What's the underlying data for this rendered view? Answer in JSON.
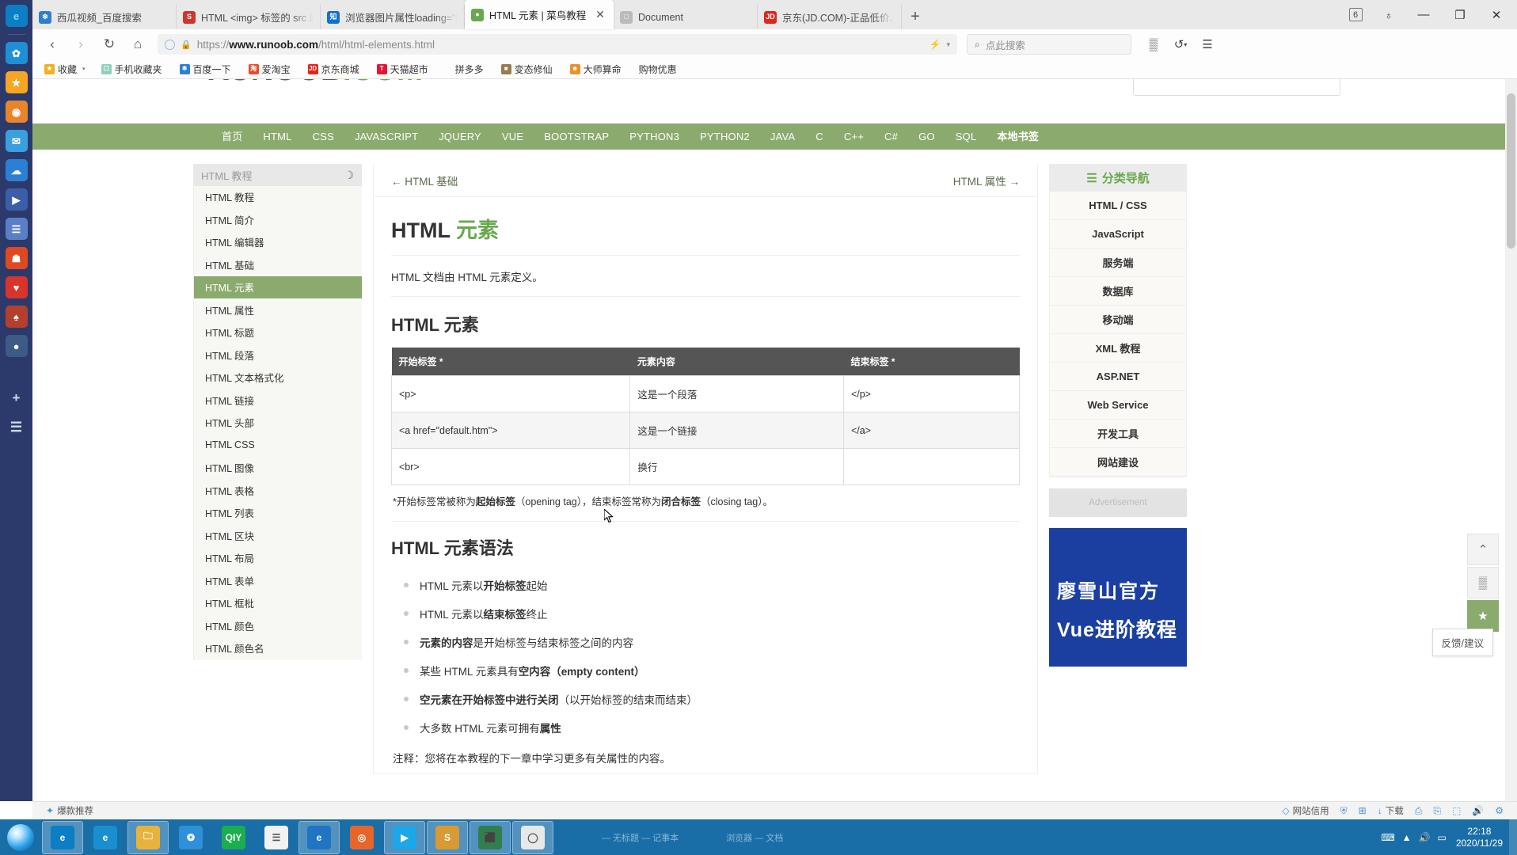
{
  "left_dock": {
    "icons": [
      {
        "name": "edge-browser-icon",
        "glyph": "e",
        "bg": "#0b7ec4",
        "fg": "#7fd4ff"
      },
      {
        "name": "flower-app-icon",
        "glyph": "✿",
        "bg": "#1f8fd6"
      },
      {
        "name": "favorites-star-icon",
        "glyph": "★",
        "bg": "#f5a623"
      },
      {
        "name": "eye-browser-icon",
        "glyph": "◉",
        "bg": "#e8852a"
      },
      {
        "name": "mail-icon",
        "glyph": "✉",
        "bg": "#3a9fdc"
      },
      {
        "name": "baidu-netdisk-icon",
        "glyph": "☁",
        "bg": "#2b7fd4"
      },
      {
        "name": "video-player-icon",
        "glyph": "▶",
        "bg": "#3b5ea8"
      },
      {
        "name": "document-app-icon",
        "glyph": "☰",
        "bg": "#5b7fc7"
      },
      {
        "name": "market-app-icon",
        "glyph": "☗",
        "bg": "#e0491f"
      },
      {
        "name": "weibo-icon",
        "glyph": "♥",
        "bg": "#d9342b"
      },
      {
        "name": "game-app-icon",
        "glyph": "♠",
        "bg": "#b43f2e"
      },
      {
        "name": "bear-app-icon",
        "glyph": "●",
        "bg": "#3e5a86"
      }
    ],
    "add_label": "+",
    "menu_label": "☰"
  },
  "tabs": [
    {
      "label": "西瓜视频_百度搜索",
      "favicon": "baidu-favicon",
      "fav_glyph": "❄",
      "fav_bg": "#2e7fd4",
      "active": false
    },
    {
      "label": "HTML <img> 标签的 src 属",
      "favicon": "csdn-favicon",
      "fav_glyph": "S",
      "fav_bg": "#d0342c",
      "active": false
    },
    {
      "label": "浏览器图片属性loading=\"la",
      "favicon": "zhihu-favicon",
      "fav_glyph": "知",
      "fav_bg": "#0e6fd9",
      "active": false
    },
    {
      "label": "HTML 元素 | 菜鸟教程",
      "favicon": "runoob-favicon",
      "fav_glyph": "●",
      "fav_bg": "#6aa84f",
      "active": true
    },
    {
      "label": "Document",
      "favicon": "blank-page-favicon",
      "fav_glyph": "□",
      "fav_bg": "#bbbbbb",
      "active": false
    },
    {
      "label": "京东(JD.COM)-正品低价、品",
      "favicon": "jd-favicon",
      "fav_glyph": "JD",
      "fav_bg": "#e1251b",
      "active": false
    }
  ],
  "tab_close_glyph": "✕",
  "tabstrip": {
    "new_tab_label": "+",
    "tab_count": "6",
    "shirt_icon_glyph": "♁",
    "minimize": "—",
    "restore": "❐",
    "close": "✕"
  },
  "toolbar": {
    "back": "‹",
    "forward": "›",
    "reload": "↻",
    "home": "⌂",
    "lock_glyph": "🔒",
    "url_prefix": "https://",
    "url_host": "www.runoob.com",
    "url_path": "/html/html-elements.html",
    "flash_glyph": "⚡",
    "chevron_glyph": "▾",
    "search_placeholder": "点此搜索",
    "search_icon_glyph": "⌕",
    "apps_icon_glyph": "▒",
    "history_icon_glyph": "↺",
    "menu_icon_glyph": "☰"
  },
  "bookmarks": {
    "items": [
      {
        "label": "收藏",
        "ico": "star-icon",
        "glyph": "★",
        "bg": "#f2b01e",
        "caret": true
      },
      {
        "label": "手机收藏夹",
        "ico": "phone-folder-icon",
        "glyph": "☐",
        "bg": "#8ecfbd"
      },
      {
        "label": "百度一下",
        "ico": "baidu-icon",
        "glyph": "❄",
        "bg": "#2e7fd4"
      },
      {
        "label": "爱淘宝",
        "ico": "taobao-icon",
        "glyph": "淘",
        "bg": "#e74c28"
      },
      {
        "label": "京东商城",
        "ico": "jd-icon",
        "glyph": "JD",
        "bg": "#e1251b"
      },
      {
        "label": "天猫超市",
        "ico": "tmall-icon",
        "glyph": "T",
        "bg": "#e31436"
      },
      {
        "label": "拼多多",
        "ico": "pdd-icon",
        "glyph": "",
        "bg": "transparent"
      },
      {
        "label": "变态修仙",
        "ico": "game-icon",
        "glyph": "■",
        "bg": "#9a7b4f"
      },
      {
        "label": "大师算命",
        "ico": "fortune-icon",
        "glyph": "☻",
        "bg": "#e8932a"
      },
      {
        "label": "购物优惠",
        "ico": "coupon-icon",
        "glyph": "",
        "bg": "transparent"
      }
    ]
  },
  "webpage": {
    "logo_text": "RUNOOB",
    "logo_suffix": ".COM",
    "search_placeholder": "",
    "nav": [
      "首页",
      "HTML",
      "CSS",
      "JAVASCRIPT",
      "JQUERY",
      "VUE",
      "BOOTSTRAP",
      "PYTHON3",
      "PYTHON2",
      "JAVA",
      "C",
      "C++",
      "C#",
      "GO",
      "SQL",
      "本地书签"
    ],
    "left_menu": {
      "header": "HTML 教程",
      "moon_icon": "☽",
      "items": [
        {
          "label": "HTML 教程",
          "selected": false
        },
        {
          "label": "HTML 简介",
          "selected": false
        },
        {
          "label": "HTML 编辑器",
          "selected": false
        },
        {
          "label": "HTML 基础",
          "selected": false
        },
        {
          "label": "HTML 元素",
          "selected": true
        },
        {
          "label": "HTML 属性",
          "selected": false
        },
        {
          "label": "HTML 标题",
          "selected": false
        },
        {
          "label": "HTML 段落",
          "selected": false
        },
        {
          "label": "HTML 文本格式化",
          "selected": false
        },
        {
          "label": "HTML 链接",
          "selected": false
        },
        {
          "label": "HTML 头部",
          "selected": false
        },
        {
          "label": "HTML CSS",
          "selected": false
        },
        {
          "label": "HTML 图像",
          "selected": false
        },
        {
          "label": "HTML 表格",
          "selected": false
        },
        {
          "label": "HTML 列表",
          "selected": false
        },
        {
          "label": "HTML 区块",
          "selected": false
        },
        {
          "label": "HTML 布局",
          "selected": false
        },
        {
          "label": "HTML 表单",
          "selected": false
        },
        {
          "label": "HTML 框枇",
          "selected": false
        },
        {
          "label": "HTML 颜色",
          "selected": false
        },
        {
          "label": "HTML 颜色名",
          "selected": false
        }
      ]
    },
    "breadcrumb": {
      "prev_arrow": "←",
      "prev": "HTML 基础",
      "next": "HTML 属性",
      "next_arrow": "→"
    },
    "title_main": "HTML ",
    "title_accent": "元素",
    "lead": "HTML 文档由 HTML 元素定义。",
    "section1_heading": "HTML 元素",
    "table": {
      "headers": [
        "开始标签 *",
        "元素内容",
        "结束标签 *"
      ],
      "rows": [
        [
          "<p>",
          "这是一个段落",
          "</p>"
        ],
        [
          "<a href=\"default.htm\">",
          "这是一个链接",
          "</a>"
        ],
        [
          "<br>",
          "换行",
          ""
        ]
      ]
    },
    "table_note_parts": [
      "*开始标签常被称为",
      "起始标签",
      "（opening tag），结束标签常称为",
      "闭合标签",
      "（closing tag）。"
    ],
    "section2_heading": "HTML 元素语法",
    "syntax_list": [
      {
        "pre": "HTML 元素以",
        "bold": "开始标签",
        "post": "起始"
      },
      {
        "pre": "HTML 元素以",
        "bold": "结束标签",
        "post": "终止"
      },
      {
        "pre": "",
        "bold": "元素的内容",
        "post": "是开始标签与结束标签之间的内容"
      },
      {
        "pre": "某些 HTML 元素具有",
        "bold": "空内容（empty content）",
        "post": ""
      },
      {
        "pre": "",
        "bold": "空元素在开始标签中进行关闭",
        "post": "（以开始标签的结束而结束）"
      },
      {
        "pre": "大多数 HTML 元素可拥有",
        "bold": "属性",
        "post": ""
      }
    ],
    "tail_text": "注释：您将在本教程的下一章中学习更多有关属性的内容。",
    "right_sidebar": {
      "header": "分类导航",
      "header_icon": "☰",
      "categories": [
        "HTML / CSS",
        "JavaScript",
        "服务端",
        "数据库",
        "移动端",
        "XML 教程",
        "ASP.NET",
        "Web Service",
        "开发工具",
        "网站建设"
      ],
      "ad_label": "Advertisement",
      "ad_line1": "廖雪山官方",
      "ad_line2": "Vue进阶教程"
    },
    "rail": {
      "up_icon": "⌃",
      "qr_icon": "▒",
      "star_icon": "★"
    },
    "feedback_tip": "反馈/建议"
  },
  "statusbar": {
    "left_label": "爆款推荐",
    "left_icon": "✦",
    "items": [
      {
        "label": "网站信用",
        "icon": "◇"
      },
      {
        "label": "",
        "icon": "⛨"
      },
      {
        "label": "",
        "icon": "⊞"
      },
      {
        "label": "下载",
        "icon": "↓"
      },
      {
        "label": "",
        "icon": "⎙"
      },
      {
        "label": "",
        "icon": "⎘"
      },
      {
        "label": "",
        "icon": "⬚"
      },
      {
        "label": "",
        "icon": "🔊"
      },
      {
        "label": "",
        "icon": "⚙"
      }
    ]
  },
  "taskbar": {
    "apps": [
      {
        "name": "taskbar-edge",
        "glyph": "e",
        "bg": "#0b7ec4",
        "running": true
      },
      {
        "name": "taskbar-ie",
        "glyph": "e",
        "bg": "#1a8fd0",
        "running": false
      },
      {
        "name": "taskbar-explorer",
        "glyph": "🗀",
        "bg": "#e8b33c",
        "running": true
      },
      {
        "name": "taskbar-chat",
        "glyph": "❂",
        "bg": "#2f8fd8",
        "running": false
      },
      {
        "name": "taskbar-iqiyi",
        "glyph": "QIY",
        "bg": "#1bae4e",
        "running": false
      },
      {
        "name": "taskbar-notepad",
        "glyph": "☰",
        "bg": "#f2f2f2",
        "running": false
      },
      {
        "name": "taskbar-browser2",
        "glyph": "e",
        "bg": "#2074c4",
        "running": true
      },
      {
        "name": "taskbar-compass",
        "glyph": "◎",
        "bg": "#e8652a",
        "running": false
      },
      {
        "name": "taskbar-youku",
        "glyph": "▶",
        "bg": "#1ba7e8",
        "running": true
      },
      {
        "name": "taskbar-sublime",
        "glyph": "S",
        "bg": "#d89a32",
        "running": true
      },
      {
        "name": "taskbar-image",
        "glyph": "⬛",
        "bg": "#2f7f4f",
        "running": true
      },
      {
        "name": "taskbar-chrome",
        "glyph": "◯",
        "bg": "#e8e8e8",
        "running": true
      }
    ],
    "window_titles": [
      "— 无标题 — 记事本",
      "浏览器 — 文档"
    ],
    "tray_icons": [
      "⌨",
      "▲",
      "🔊",
      "▭"
    ],
    "clock_time": "22:18",
    "clock_date": "2020/11/29"
  }
}
